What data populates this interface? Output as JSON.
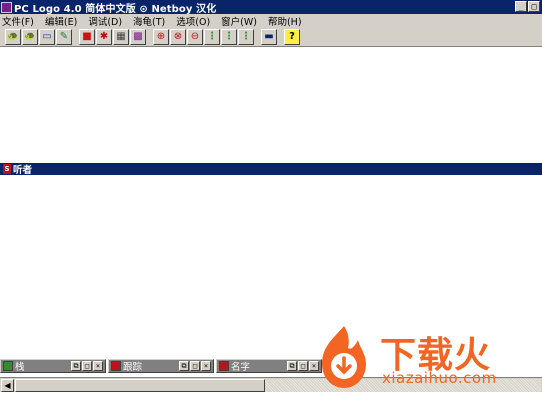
{
  "window": {
    "title": "PC Logo 4.0 简体中文版  ⊙ Netboy  汉化",
    "minimize": "_",
    "maximize": "□"
  },
  "menu": [
    {
      "label": "文件(F)"
    },
    {
      "label": "编辑(E)"
    },
    {
      "label": "调试(D)"
    },
    {
      "label": "海龟(T)"
    },
    {
      "label": "选项(O)"
    },
    {
      "label": "窗户(W)"
    },
    {
      "label": "帮助(H)"
    }
  ],
  "toolbar": [
    {
      "icon": "new-turtle-icon",
      "glyph": "🐢"
    },
    {
      "icon": "load-turtle-icon",
      "glyph": "🐢"
    },
    {
      "icon": "open-tray-icon",
      "glyph": "▭"
    },
    {
      "icon": "edit-pencil-icon",
      "glyph": "✎"
    },
    {
      "icon": "stop-icon",
      "glyph": "■"
    },
    {
      "icon": "pause-icon",
      "glyph": "✱"
    },
    {
      "icon": "grid-icon",
      "glyph": "▦"
    },
    {
      "icon": "palette-icon",
      "glyph": "▩"
    },
    {
      "icon": "zoom-in-icon",
      "glyph": "⊕"
    },
    {
      "icon": "zoom-turtle-icon",
      "glyph": "⊗"
    },
    {
      "icon": "zoom-out-icon",
      "glyph": "⊖"
    },
    {
      "icon": "traffic-light-icon",
      "glyph": "⋮"
    },
    {
      "icon": "traffic-light-icon",
      "glyph": "⋮"
    },
    {
      "icon": "traffic-light-icon",
      "glyph": "⋮"
    },
    {
      "icon": "screen-icon",
      "glyph": "▬"
    },
    {
      "icon": "help-icon",
      "glyph": "?"
    }
  ],
  "listener": {
    "title": "听者",
    "icon_glyph": "S"
  },
  "minimized_windows": [
    {
      "label": "栈"
    },
    {
      "label": "跟踪"
    },
    {
      "label": "名字"
    }
  ],
  "window_buttons": {
    "restore": "⧉",
    "maximize": "□",
    "close": "×"
  },
  "scrollbar": {
    "left_arrow": "◀"
  },
  "watermark": {
    "brand": "下载火",
    "domain": "xiazaihuo.com"
  },
  "colors": {
    "titlebar": "#0a246a",
    "watermark": "#f26522"
  }
}
